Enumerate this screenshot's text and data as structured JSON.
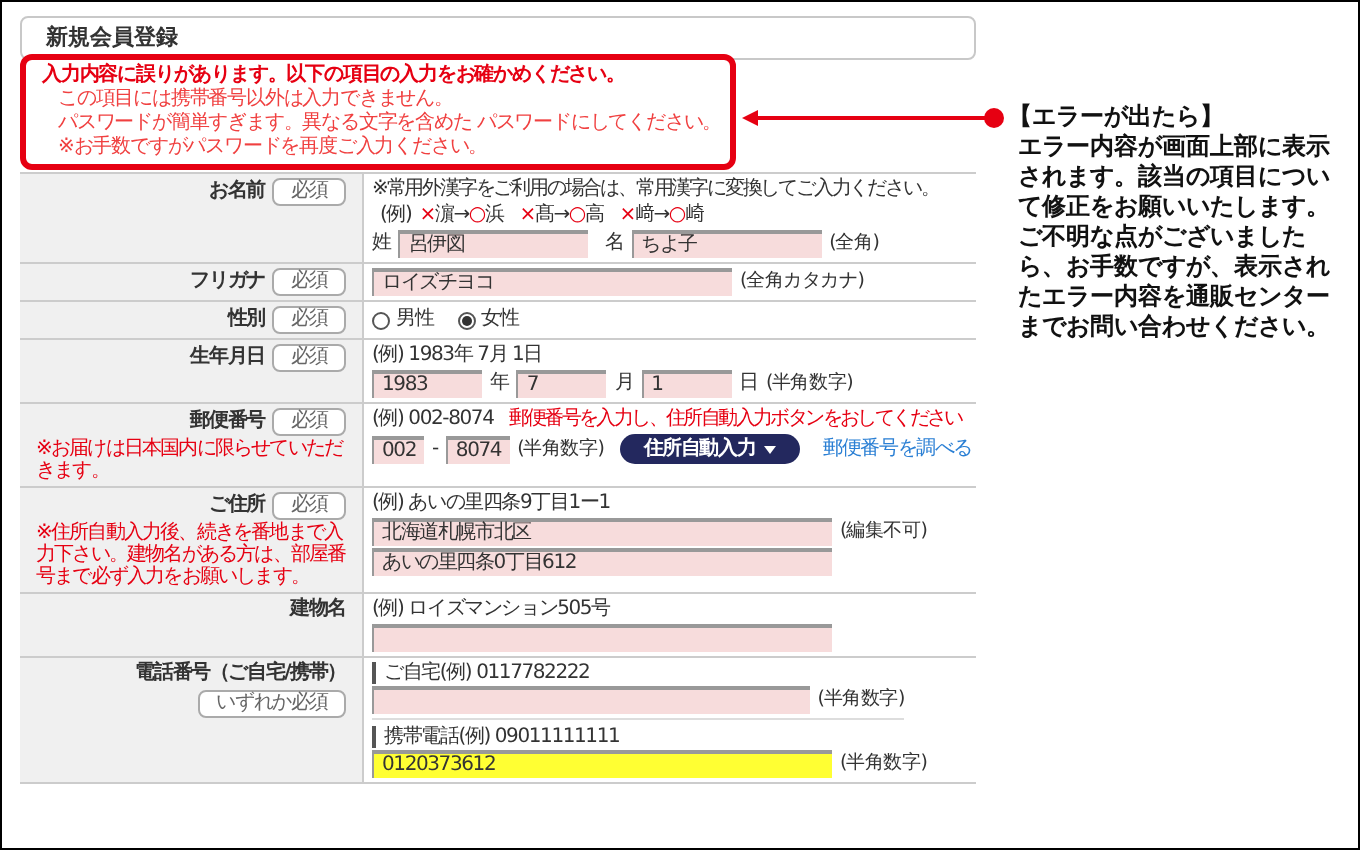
{
  "title": "新規会員登録",
  "errors": {
    "heading": "入力内容に誤りがあります。以下の項目の入力をお確かめください。",
    "messages": [
      "この項目には携帯番号以外は入力できません。",
      "パスワードが簡単すぎます。異なる文字を含めた パスワードにしてください。",
      "※お手数ですがパスワードを再度ご入力ください。"
    ]
  },
  "callout": {
    "heading": "【エラーが出たら】",
    "body": "エラー内容が画面上部に表示されます。該当の項目について修正をお願いいたします。ご不明な点がございましたら、お手数ですが、表示されたエラー内容を通販センターまでお問い合わせください。"
  },
  "rows": [
    {
      "kind": "name",
      "label": "お名前",
      "badge": "必須",
      "note": "※常用外漢字をご利用の場合は、常用漢字に変換してご入力ください。",
      "example_prefix": "(例)",
      "examples": [
        {
          "cross": "×",
          "from": "濵",
          "arrow": "→",
          "circle": "○",
          "to": "浜"
        },
        {
          "cross": "×",
          "from": "髙",
          "arrow": "→",
          "circle": "○",
          "to": "高"
        },
        {
          "cross": "×",
          "from": "﨑",
          "arrow": "→",
          "circle": "○",
          "to": "崎"
        }
      ],
      "fields": [
        {
          "prefix": "姓",
          "value": "呂伊図"
        },
        {
          "prefix": "名",
          "value": "ちよ子"
        }
      ],
      "suffix": "(全角)"
    },
    {
      "kind": "text",
      "label": "フリガナ",
      "badge": "必須",
      "value": "ロイズチヨコ",
      "suffix": "(全角カタカナ)"
    },
    {
      "kind": "radio",
      "label": "性別",
      "badge": "必須",
      "options": [
        {
          "label": "男性",
          "selected": false
        },
        {
          "label": "女性",
          "selected": true
        }
      ]
    },
    {
      "kind": "date",
      "label": "生年月日",
      "badge": "必須",
      "example": "(例) 1983年 7月 1日",
      "parts": [
        {
          "value": "1983",
          "unit": "年"
        },
        {
          "value": "7",
          "unit": "月"
        },
        {
          "value": "1",
          "unit": "日"
        }
      ],
      "suffix": "(半角数字)"
    },
    {
      "kind": "postal",
      "label": "郵便番号",
      "badge": "必須",
      "side_note": "※お届けは日本国内に限らせていただきます。",
      "example": "(例) 002-8074",
      "hint": "郵便番号を入力し、住所自動入力ボタンをおしてください",
      "values": [
        "002",
        "8074"
      ],
      "separator": "-",
      "suffix": "(半角数字)",
      "button": "住所自動入力",
      "link": "郵便番号を調べる"
    },
    {
      "kind": "address",
      "label": "ご住所",
      "badge": "必須",
      "side_note": "※住所自動入力後、続きを番地まで入力下さい。建物名がある方は、部屋番号まで必ず入力をお願いします。",
      "example": "(例) あいの里四条9丁目1ー1",
      "lines": [
        "北海道札幌市北区",
        "あいの里四条0丁目612"
      ],
      "suffix": "(編集不可)"
    },
    {
      "kind": "building",
      "label": "建物名",
      "example": "(例) ロイズマンション505号"
    },
    {
      "kind": "phone",
      "label": "電話番号（ご自宅/携帯）",
      "badge": "いずれか必須",
      "groups": [
        {
          "caption": "ご自宅(例) 0117782222",
          "error": false,
          "suffix": "(半角数字)"
        },
        {
          "caption": "携帯電話(例) 09011111111",
          "value": "0120373612",
          "error": true,
          "suffix": "(半角数字)"
        }
      ]
    }
  ]
}
